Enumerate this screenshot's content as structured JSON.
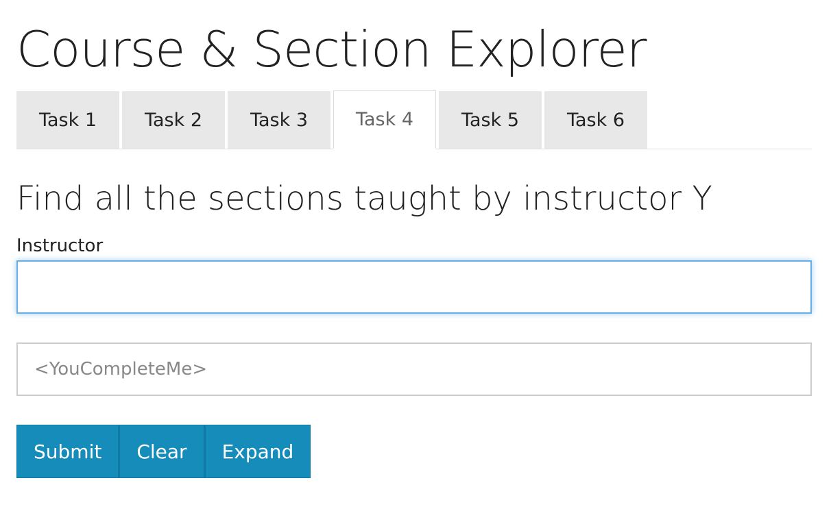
{
  "header": {
    "title": "Course & Section Explorer"
  },
  "tabs": [
    {
      "label": "Task 1",
      "active": false
    },
    {
      "label": "Task 2",
      "active": false
    },
    {
      "label": "Task 3",
      "active": false
    },
    {
      "label": "Task 4",
      "active": true
    },
    {
      "label": "Task 5",
      "active": false
    },
    {
      "label": "Task 6",
      "active": false
    }
  ],
  "task": {
    "heading": "Find all the sections taught by instructor Y",
    "instructor_label": "Instructor",
    "instructor_value": "",
    "autocomplete_placeholder": "<YouCompleteMe>"
  },
  "buttons": {
    "submit": "Submit",
    "clear": "Clear",
    "expand": "Expand"
  },
  "colors": {
    "accent": "#168cba",
    "focus_border": "#66afe9",
    "tab_bg": "#e8e8e8"
  }
}
